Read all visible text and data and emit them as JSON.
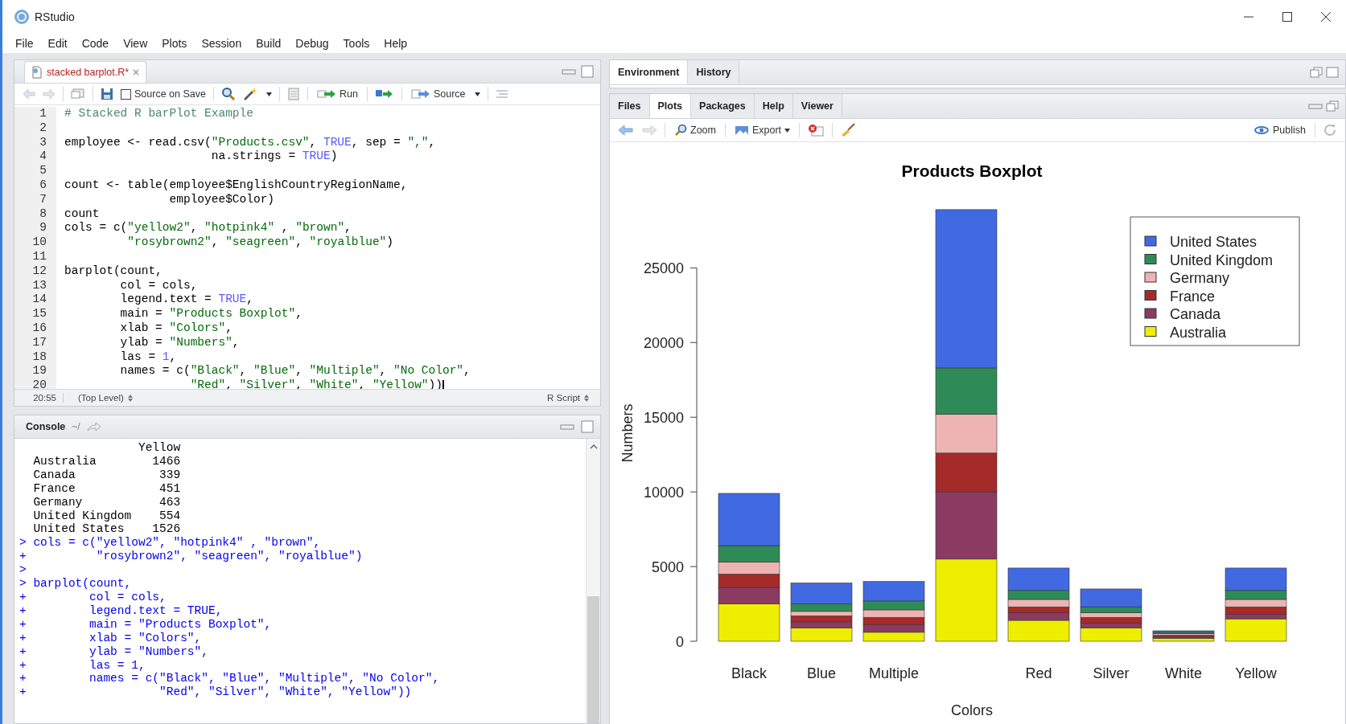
{
  "window": {
    "title": "RStudio"
  },
  "menu": [
    "File",
    "Edit",
    "Code",
    "View",
    "Plots",
    "Session",
    "Build",
    "Debug",
    "Tools",
    "Help"
  ],
  "editor": {
    "tabs": [
      {
        "label": "stacked barplot.R*",
        "selected": true
      }
    ],
    "toolbar": {
      "source_on_save": {
        "label": "Source on Save",
        "checked": false
      },
      "run": "Run",
      "source": "Source"
    },
    "lines": [
      {
        "number": "1",
        "text": "# Stacked R barPlot Example"
      },
      {
        "number": "2"
      },
      {
        "number": "3",
        "text": "employee <- read.csv(\"Products.csv\", TRUE, sep = \",\","
      },
      {
        "number": "4",
        "text": "                     na.strings = TRUE)"
      },
      {
        "number": "5"
      },
      {
        "number": "6",
        "text": "count <- table(employee$EnglishCountryRegionName,"
      },
      {
        "number": "7",
        "text": "               employee$Color)"
      },
      {
        "number": "8",
        "text": "count"
      },
      {
        "number": "9",
        "text": "cols = c(\"yellow2\", \"hotpink4\" , \"brown\","
      },
      {
        "number": "10",
        "text": "         \"rosybrown2\", \"seagreen\", \"royalblue\")"
      },
      {
        "number": "11"
      },
      {
        "number": "12",
        "text": "barplot(count,"
      },
      {
        "number": "13",
        "text": "        col = cols,"
      },
      {
        "number": "14",
        "text": "        legend.text = TRUE,"
      },
      {
        "number": "15",
        "text": "        main = \"Products Boxplot\","
      },
      {
        "number": "16",
        "text": "        xlab = \"Colors\","
      },
      {
        "number": "17",
        "text": "        ylab = \"Numbers\","
      },
      {
        "number": "18",
        "text": "        las = 1,"
      },
      {
        "number": "19",
        "text": "        names = c(\"Black\", \"Blue\", \"Multiple\", \"No Color\","
      },
      {
        "number": "20",
        "text": "                  \"Red\", \"Silver\", \"White\", \"Yellow\"))"
      }
    ],
    "status": {
      "position": "20:55",
      "scope": "(Top Level)",
      "file_type": "R Script"
    }
  },
  "console": {
    "title": "Console",
    "path": "~/",
    "lines": [
      {
        "kind": "output",
        "text": "                 Yellow"
      },
      {
        "kind": "output",
        "text": "  Australia        1466"
      },
      {
        "kind": "output",
        "text": "  Canada            339"
      },
      {
        "kind": "output",
        "text": "  France            451"
      },
      {
        "kind": "output",
        "text": "  Germany           463"
      },
      {
        "kind": "output",
        "text": "  United Kingdom    554"
      },
      {
        "kind": "output",
        "text": "  United States    1526"
      },
      {
        "kind": "input",
        "text": "> cols = c(\"yellow2\", \"hotpink4\" , \"brown\","
      },
      {
        "kind": "input",
        "text": "+          \"rosybrown2\", \"seagreen\", \"royalblue\")"
      },
      {
        "kind": "input",
        "text": ">"
      },
      {
        "kind": "input",
        "text": "> barplot(count,"
      },
      {
        "kind": "input",
        "text": "+         col = cols,"
      },
      {
        "kind": "input",
        "text": "+         legend.text = TRUE,"
      },
      {
        "kind": "input",
        "text": "+         main = \"Products Boxplot\","
      },
      {
        "kind": "input",
        "text": "+         xlab = \"Colors\","
      },
      {
        "kind": "input",
        "text": "+         ylab = \"Numbers\","
      },
      {
        "kind": "input",
        "text": "+         las = 1,"
      },
      {
        "kind": "input",
        "text": "+         names = c(\"Black\", \"Blue\", \"Multiple\", \"No Color\","
      },
      {
        "kind": "input",
        "text": "+                   \"Red\", \"Silver\", \"White\", \"Yellow\"))"
      }
    ]
  },
  "environment": {
    "tabs": [
      {
        "label": "Environment",
        "selected": true
      },
      {
        "label": "History",
        "selected": false
      }
    ]
  },
  "files": {
    "tabs": [
      {
        "label": "Files",
        "selected": false
      },
      {
        "label": "Plots",
        "selected": true
      },
      {
        "label": "Packages",
        "selected": false
      },
      {
        "label": "Help",
        "selected": false
      },
      {
        "label": "Viewer",
        "selected": false
      }
    ],
    "toolbar": {
      "zoom": "Zoom",
      "export": "Export",
      "publish": "Publish"
    },
    "chart_data": {
      "type": "bar",
      "stacked": true,
      "title": "Products Boxplot",
      "xlabel": "Colors",
      "ylabel": "Numbers",
      "categories": [
        "Black",
        "Blue",
        "Multiple",
        null,
        "Red",
        "Silver",
        "White",
        "Yellow"
      ],
      "ylim": [
        0,
        29000
      ],
      "yticks": [
        0,
        5000,
        10000,
        15000,
        20000,
        25000
      ],
      "legend": true,
      "series": [
        {
          "name": "Australia",
          "color": "#eeee00",
          "values": [
            2500,
            900,
            600,
            5500,
            1400,
            900,
            200,
            1500
          ]
        },
        {
          "name": "Canada",
          "color": "#8b3a62",
          "values": [
            1100,
            400,
            500,
            4500,
            500,
            300,
            100,
            300
          ]
        },
        {
          "name": "France",
          "color": "#a52a2a",
          "values": [
            900,
            400,
            500,
            2600,
            400,
            400,
            100,
            500
          ]
        },
        {
          "name": "Germany",
          "color": "#eeb4b4",
          "values": [
            800,
            300,
            500,
            2600,
            500,
            300,
            100,
            500
          ]
        },
        {
          "name": "United Kingdom",
          "color": "#2e8b57",
          "values": [
            1100,
            500,
            600,
            3100,
            600,
            400,
            100,
            600
          ]
        },
        {
          "name": "United States",
          "color": "#4169e1",
          "values": [
            3500,
            1400,
            1300,
            10600,
            1500,
            1200,
            100,
            1500
          ]
        }
      ]
    }
  }
}
